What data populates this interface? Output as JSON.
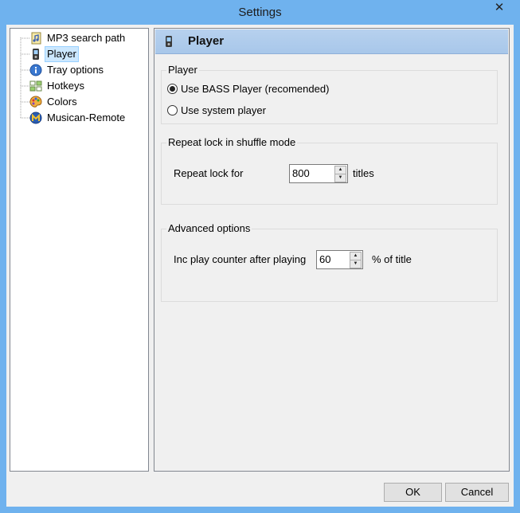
{
  "window": {
    "title": "Settings",
    "close_glyph": "✕"
  },
  "tree": {
    "items": [
      {
        "label": "MP3 search path",
        "icon": "music-file-icon"
      },
      {
        "label": "Player",
        "icon": "phone-player-icon"
      },
      {
        "label": "Tray options",
        "icon": "info-icon"
      },
      {
        "label": "Hotkeys",
        "icon": "keyboard-icon"
      },
      {
        "label": "Colors",
        "icon": "palette-icon"
      },
      {
        "label": "Musican-Remote",
        "icon": "remote-m-icon"
      }
    ],
    "selected_index": 1
  },
  "panel": {
    "title": "Player",
    "player_group": {
      "legend": "Player",
      "options": [
        {
          "label": "Use BASS Player (recomended)",
          "checked": true
        },
        {
          "label": "Use system player",
          "checked": false
        }
      ]
    },
    "repeat_group": {
      "legend": "Repeat lock in shuffle mode",
      "label": "Repeat lock for",
      "value": "800",
      "suffix": "titles"
    },
    "advanced_group": {
      "legend": "Advanced options",
      "label": "Inc play counter after playing",
      "value": "60",
      "suffix": "% of title"
    }
  },
  "buttons": {
    "ok": "OK",
    "cancel": "Cancel"
  },
  "colors": {
    "titlebar": "#6fb2ee",
    "header": "#b7d1ee",
    "selection": "#cce8ff"
  }
}
